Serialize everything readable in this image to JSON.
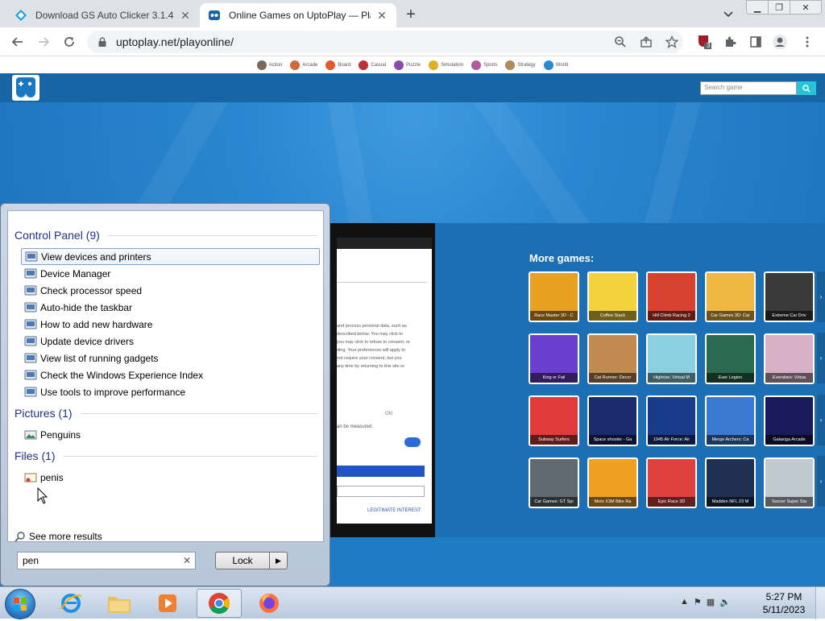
{
  "browser": {
    "tabs": [
      {
        "title": "Download GS Auto Clicker 3.1.4 for",
        "favicon_color": "#1ba1e2"
      },
      {
        "title": "Online Games on UptoPlay — Play B",
        "favicon_color": "#1865a6"
      }
    ],
    "new_tab_label": "+",
    "url": "uptoplay.net/playonline/",
    "extension_badge": "3"
  },
  "site": {
    "categories": [
      "Action",
      "Arcade",
      "Board",
      "Casual",
      "Puzzle",
      "Simulation",
      "Sports",
      "Strategy",
      "World"
    ],
    "search_placeholder": "Search game",
    "more_games_title": "More games:",
    "embedded_page": {
      "text_lines": [
        "and process personal data, such as",
        "described below. You may click to",
        "you may click to refuse to consent, or",
        "ding. Your preferences will apply to",
        "not require your consent, but you",
        "any time by returning to this site or"
      ],
      "dropdown_value": "ON",
      "measured_text": "an be measured.",
      "link_text": "LEGITIMATE INTEREST"
    },
    "games": [
      [
        "Race Master 3D - C",
        "Coffee Stack",
        "Hill Climb Racing 2",
        "Car Games 3D: Car",
        "Extreme Car Driv"
      ],
      [
        "King or Fail",
        "Cat Runner: Decor",
        "Highrise: Virtual M",
        "Ever Legion",
        "Everskies: Virtua"
      ],
      [
        "Subway Surfers",
        "Space shooter - Ga",
        "1945 Air Force: Air",
        "Merge Archers: Ca",
        "Galaxiga Arcade"
      ],
      [
        "Car Games: GT Spi",
        "Moto X3M Bike Ra",
        "Epic Race 3D",
        "Madden NFL 23 M",
        "Soccer Super Sta"
      ]
    ],
    "game_colors": [
      [
        "#e8a020",
        "#f3d23a",
        "#d84030",
        "#f0b840",
        "#3a3a3a"
      ],
      [
        "#6a3fd0",
        "#c08a50",
        "#8ad0e0",
        "#2a6a50",
        "#d8b0c8"
      ],
      [
        "#e03a3a",
        "#1a2a6a",
        "#1a3a8a",
        "#3a7ad0",
        "#1a1a5a"
      ],
      [
        "#606a70",
        "#f0a020",
        "#e04040",
        "#203050",
        "#c0c8d0"
      ]
    ]
  },
  "start_menu": {
    "groups": [
      {
        "title": "Control Panel (9)",
        "items": [
          "View devices and printers",
          "Device Manager",
          "Check processor speed",
          "Auto-hide the taskbar",
          "How to add new hardware",
          "Update device drivers",
          "View list of running gadgets",
          "Check the Windows Experience Index",
          "Use tools to improve performance"
        ]
      },
      {
        "title": "Pictures (1)",
        "items": [
          "Penguins"
        ]
      },
      {
        "title": "Files (1)",
        "items": [
          "penis"
        ]
      }
    ],
    "see_more": "See more results",
    "search_value": "pen",
    "lock_button": "Lock"
  },
  "taskbar": {
    "apps": [
      "internet-explorer",
      "file-explorer",
      "media-player",
      "chrome",
      "firefox"
    ],
    "time": "5:27 PM",
    "date": "5/11/2023"
  }
}
